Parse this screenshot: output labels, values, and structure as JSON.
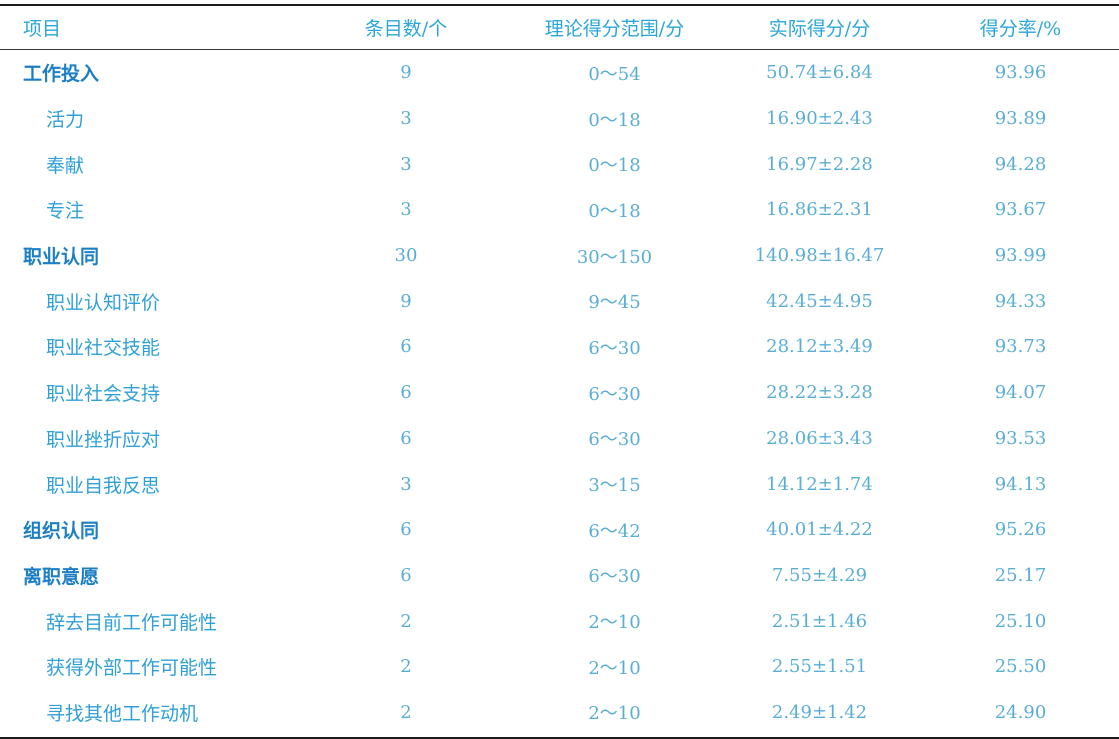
{
  "table": {
    "headers": {
      "item": "项目",
      "count": "条目数/个",
      "range": "理论得分范围/分",
      "score": "实际得分/分",
      "rate": "得分率/%"
    },
    "rows": [
      {
        "type": "group",
        "item": "工作投入",
        "count": "9",
        "range": "0～54",
        "score": "50.74±6.84",
        "rate": "93.96"
      },
      {
        "type": "sub",
        "item": "活力",
        "count": "3",
        "range": "0～18",
        "score": "16.90±2.43",
        "rate": "93.89"
      },
      {
        "type": "sub",
        "item": "奉献",
        "count": "3",
        "range": "0～18",
        "score": "16.97±2.28",
        "rate": "94.28"
      },
      {
        "type": "sub",
        "item": "专注",
        "count": "3",
        "range": "0～18",
        "score": "16.86±2.31",
        "rate": "93.67"
      },
      {
        "type": "group",
        "item": "职业认同",
        "count": "30",
        "range": "30～150",
        "score": "140.98±16.47",
        "rate": "93.99"
      },
      {
        "type": "sub",
        "item": "职业认知评价",
        "count": "9",
        "range": "9～45",
        "score": "42.45±4.95",
        "rate": "94.33"
      },
      {
        "type": "sub",
        "item": "职业社交技能",
        "count": "6",
        "range": "6～30",
        "score": "28.12±3.49",
        "rate": "93.73"
      },
      {
        "type": "sub",
        "item": "职业社会支持",
        "count": "6",
        "range": "6～30",
        "score": "28.22±3.28",
        "rate": "94.07"
      },
      {
        "type": "sub",
        "item": "职业挫折应对",
        "count": "6",
        "range": "6～30",
        "score": "28.06±3.43",
        "rate": "93.53"
      },
      {
        "type": "sub",
        "item": "职业自我反思",
        "count": "3",
        "range": "3～15",
        "score": "14.12±1.74",
        "rate": "94.13"
      },
      {
        "type": "group",
        "item": "组织认同",
        "count": "6",
        "range": "6～42",
        "score": "40.01±4.22",
        "rate": "95.26"
      },
      {
        "type": "group",
        "item": "离职意愿",
        "count": "6",
        "range": "6～30",
        "score": "7.55±4.29",
        "rate": "25.17"
      },
      {
        "type": "sub",
        "item": "辞去目前工作可能性",
        "count": "2",
        "range": "2～10",
        "score": "2.51±1.46",
        "rate": "25.10"
      },
      {
        "type": "sub",
        "item": "获得外部工作可能性",
        "count": "2",
        "range": "2～10",
        "score": "2.55±1.51",
        "rate": "25.50"
      },
      {
        "type": "sub",
        "item": "寻找其他工作动机",
        "count": "2",
        "range": "2～10",
        "score": "2.49±1.42",
        "rate": "24.90"
      }
    ]
  }
}
